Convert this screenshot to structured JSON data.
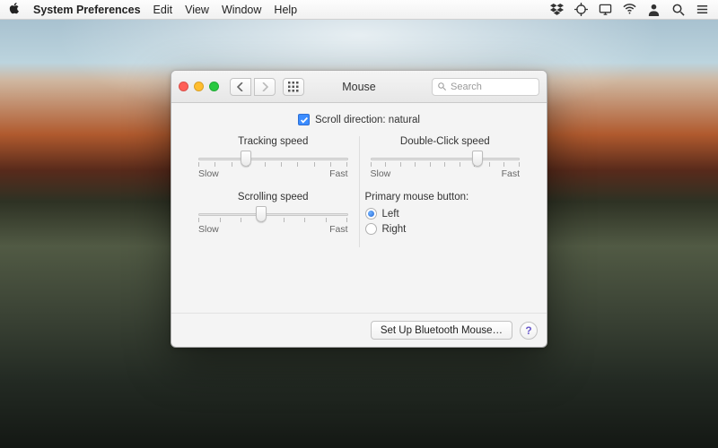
{
  "menubar": {
    "app": "System Preferences",
    "items": [
      "Edit",
      "View",
      "Window",
      "Help"
    ],
    "status_icons": [
      "dropbox-icon",
      "target-icon",
      "display-icon",
      "wifi-icon",
      "user-icon",
      "search-icon",
      "notification-icon"
    ]
  },
  "window": {
    "title": "Mouse",
    "search_placeholder": "Search",
    "scroll_direction": {
      "checked": true,
      "label": "Scroll direction: natural"
    },
    "sliders": {
      "tracking": {
        "label": "Tracking speed",
        "lo": "Slow",
        "hi": "Fast",
        "value_pct": 32,
        "ticks": 10
      },
      "scrolling": {
        "label": "Scrolling speed",
        "lo": "Slow",
        "hi": "Fast",
        "value_pct": 42,
        "ticks": 8
      },
      "doubleclick": {
        "label": "Double-Click speed",
        "lo": "Slow",
        "hi": "Fast",
        "value_pct": 72,
        "ticks": 11
      }
    },
    "primary_button": {
      "label": "Primary mouse button:",
      "options": [
        "Left",
        "Right"
      ],
      "selected": "Left"
    },
    "setup_btn": "Set Up Bluetooth Mouse…",
    "help_btn": "?"
  }
}
